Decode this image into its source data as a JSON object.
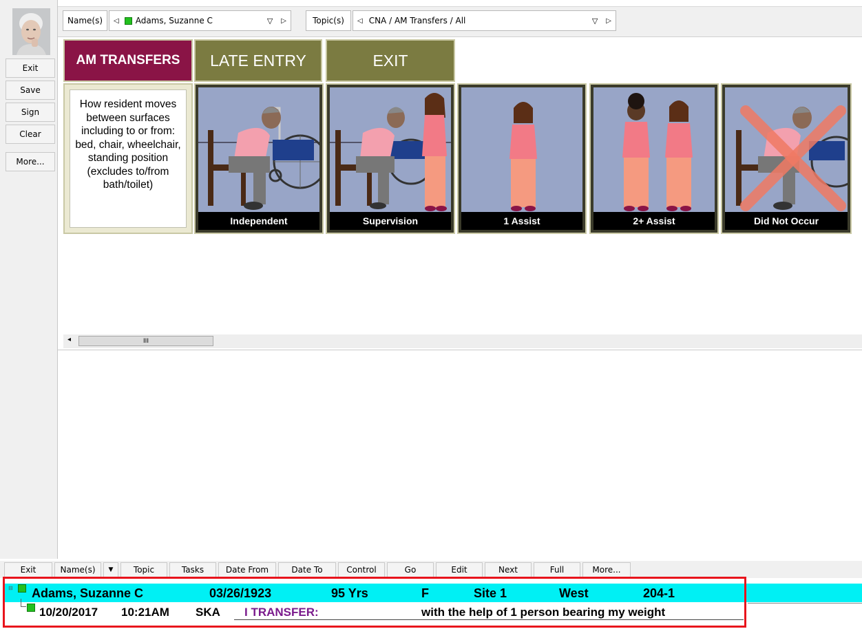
{
  "left_buttons": {
    "exit": "Exit",
    "save": "Save",
    "sign": "Sign",
    "clear": "Clear",
    "more": "More..."
  },
  "header": {
    "names_label": "Name(s)",
    "selected_name": "Adams, Suzanne C",
    "topics_label": "Topic(s)",
    "selected_topic": "CNA / AM Transfers / All"
  },
  "menu": {
    "am_transfers": "AM TRANSFERS",
    "late_entry": "LATE ENTRY",
    "exit": "EXIT"
  },
  "question": "How resident moves between surfaces including to or from: bed, chair, wheelchair, standing position (excludes to/from bath/toilet)",
  "options": [
    {
      "label": "Independent"
    },
    {
      "label": "Supervision"
    },
    {
      "label": "1 Assist"
    },
    {
      "label": "2+ Assist"
    },
    {
      "label": "Did Not Occur"
    }
  ],
  "scrollbar_thumb": "III",
  "toolbar": {
    "exit": "Exit",
    "names": "Name(s)",
    "topic": "Topic",
    "tasks": "Tasks",
    "date_from": "Date From",
    "date_to": "Date To",
    "control": "Control",
    "go": "Go",
    "edit": "Edit",
    "next": "Next",
    "full": "Full",
    "more": "More..."
  },
  "resident": {
    "name": "Adams, Suzanne C",
    "dob": "03/26/1923",
    "age": "95 Yrs",
    "sex": "F",
    "site": "Site 1",
    "unit": "West",
    "room": "204-1"
  },
  "entry": {
    "date": "10/20/2017",
    "time": "10:21AM",
    "initials": "SKA",
    "topic": "I TRANSFER:",
    "text": "with the help of 1 person bearing my weight"
  },
  "colors": {
    "am_tile": "#8a1446",
    "olive_tile": "#7b7b41",
    "scene_bg": "#98a5c7",
    "summary_bg": "#00f0f4",
    "highlight": "#e8141c",
    "topic_purple": "#7a1a8c",
    "status_green": "#22c01e"
  }
}
